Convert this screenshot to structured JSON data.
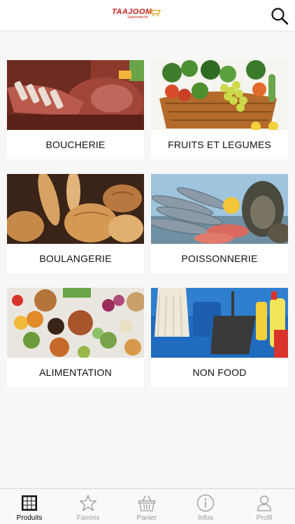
{
  "header": {
    "logo_text": "TAAJOOM",
    "logo_subtext": "Supermarché",
    "search_icon": "search-icon"
  },
  "categories": [
    {
      "label": "BOUCHERIE",
      "image": "meat-photo"
    },
    {
      "label": "FRUITS ET LEGUMES",
      "image": "fruit-basket-photo"
    },
    {
      "label": "BOULANGERIE",
      "image": "bread-photo"
    },
    {
      "label": "POISSONNERIE",
      "image": "fish-photo"
    },
    {
      "label": "ALIMENTATION",
      "image": "groceries-photo"
    },
    {
      "label": "NON FOOD",
      "image": "cleaning-supplies-photo"
    }
  ],
  "tabbar": {
    "items": [
      {
        "label": "Produits",
        "icon": "grid-icon",
        "active": true
      },
      {
        "label": "Favoris",
        "icon": "star-icon",
        "active": false
      },
      {
        "label": "Panier",
        "icon": "basket-icon",
        "active": false
      },
      {
        "label": "Infos",
        "icon": "info-icon",
        "active": false
      },
      {
        "label": "Profil",
        "icon": "profile-icon",
        "active": false
      }
    ]
  },
  "colors": {
    "brand_red": "#c8201c",
    "brand_orange": "#e8a21b",
    "tab_active": "#000000",
    "tab_inactive": "#9a9a9a"
  }
}
